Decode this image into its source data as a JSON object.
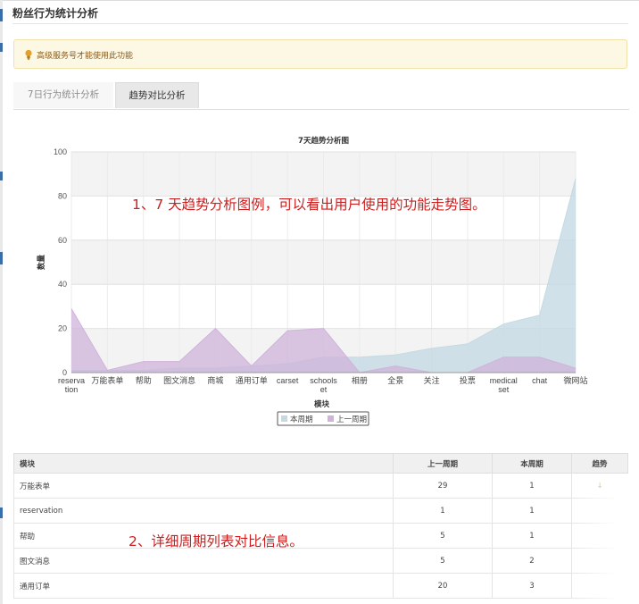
{
  "page": {
    "title": "粉丝行为统计分析"
  },
  "notice": {
    "text": "高级服务号才能使用此功能",
    "icon": "lightbulb-icon"
  },
  "tabs": [
    {
      "label": "7日行为统计分析",
      "active": false
    },
    {
      "label": "趋势对比分析",
      "active": true
    }
  ],
  "chart_data": {
    "type": "area",
    "title": "7天趋势分析图",
    "xlabel": "模块",
    "ylabel": "数量",
    "ylim": [
      0,
      100
    ],
    "yticks": [
      0,
      20,
      40,
      60,
      80,
      100
    ],
    "grid": true,
    "legend_position": "bottom",
    "categories": [
      "reservation",
      "万能表单",
      "帮助",
      "图文消息",
      "商城",
      "通用订单",
      "carset",
      "schoolset",
      "相册",
      "全景",
      "关注",
      "投票",
      "medicalset",
      "chat",
      "微网站"
    ],
    "category_display": [
      "reserva\ntion",
      "万能表单",
      "帮助",
      "图文消息",
      "商城",
      "通用订单",
      "carset",
      "schools\net",
      "相册",
      "全景",
      "关注",
      "投票",
      "medical\nset",
      "chat",
      "微网站"
    ],
    "series": [
      {
        "name": "本周期",
        "color": "#c4dae3",
        "values": [
          1,
          1,
          1,
          2,
          2,
          3,
          4,
          7,
          7,
          8,
          11,
          13,
          22,
          26,
          88
        ]
      },
      {
        "name": "上一周期",
        "color": "#cfb3db",
        "values": [
          29,
          1,
          5,
          5,
          20,
          3,
          19,
          20,
          0,
          3,
          0,
          0,
          7,
          7,
          2
        ]
      }
    ]
  },
  "annotations": {
    "chart_note": "1、7 天趋势分析图例，可以看出用户使用的功能走势图。",
    "table_note": "2、详细周期列表对比信息。"
  },
  "table": {
    "headers": [
      "模块",
      "上一周期",
      "本周期",
      "趋势"
    ],
    "rows": [
      {
        "module": "万能表单",
        "prev": "29",
        "curr": "1",
        "trend": "↓"
      },
      {
        "module": "reservation",
        "prev": "1",
        "curr": "1",
        "trend": ""
      },
      {
        "module": "帮助",
        "prev": "5",
        "curr": "1",
        "trend": ""
      },
      {
        "module": "图文消息",
        "prev": "5",
        "curr": "2",
        "trend": ""
      },
      {
        "module": "通用订单",
        "prev": "20",
        "curr": "3",
        "trend": ""
      }
    ]
  }
}
